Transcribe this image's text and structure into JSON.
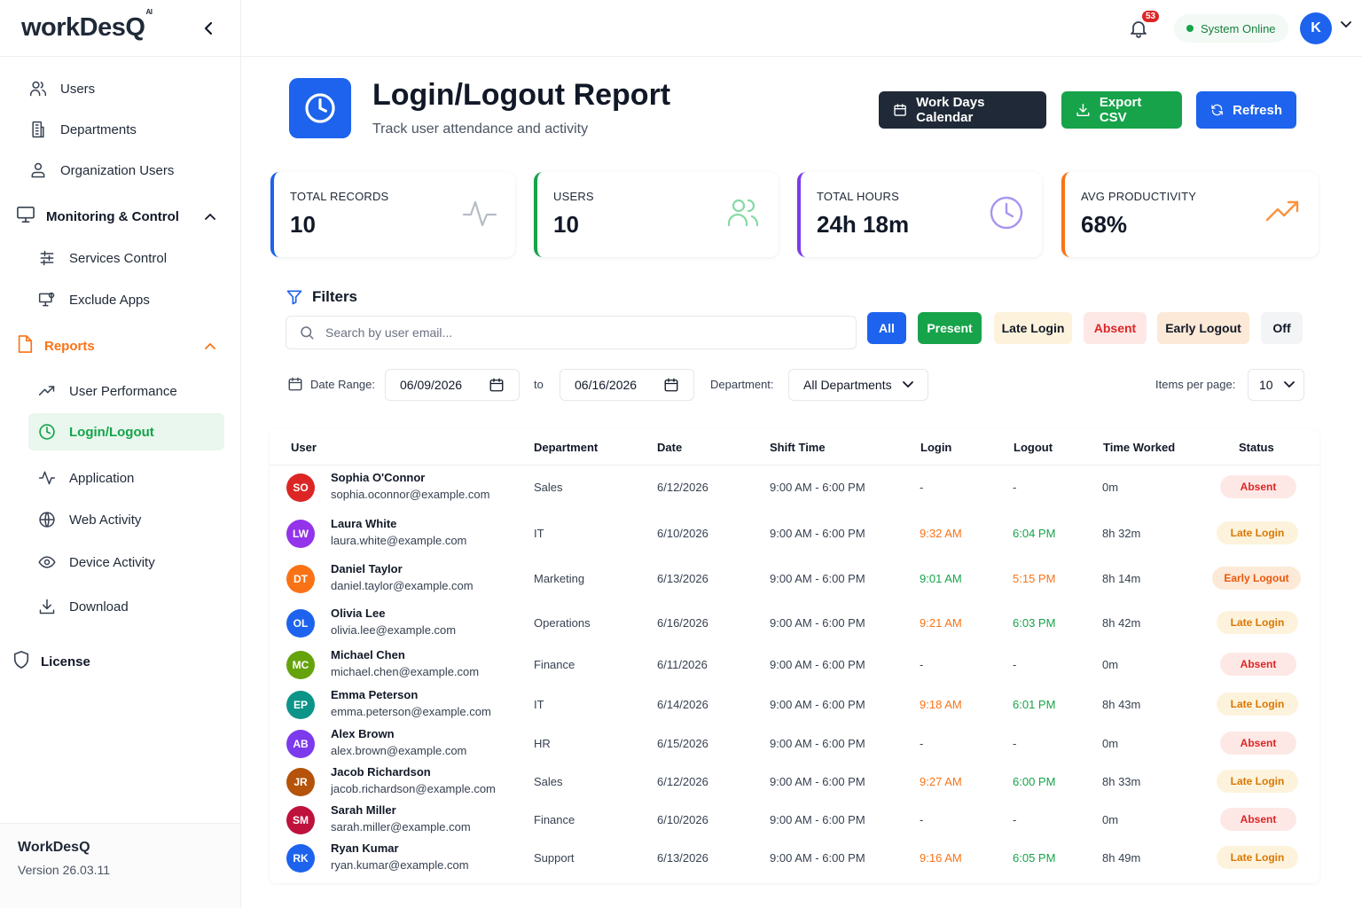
{
  "app": {
    "logo": "workDesQ",
    "logo_sup": "AI"
  },
  "sidebar": {
    "items": [
      {
        "label": "Users",
        "icon": "users-icon"
      },
      {
        "label": "Departments",
        "icon": "building-icon"
      },
      {
        "label": "Organization Users",
        "icon": "org-users-icon"
      }
    ],
    "monitoring": {
      "label": "Monitoring & Control",
      "children": [
        {
          "label": "Services Control",
          "icon": "sliders-icon"
        },
        {
          "label": "Exclude Apps",
          "icon": "monitor-gear-icon"
        }
      ]
    },
    "reports": {
      "label": "Reports",
      "children": [
        {
          "label": "User Performance",
          "icon": "trend-icon"
        },
        {
          "label": "Login/Logout",
          "icon": "clock-icon"
        },
        {
          "label": "Application",
          "icon": "activity-icon"
        },
        {
          "label": "Web Activity",
          "icon": "globe-icon"
        },
        {
          "label": "Device Activity",
          "icon": "eye-icon"
        },
        {
          "label": "Download",
          "icon": "download-icon"
        }
      ]
    },
    "license": "License",
    "footer": {
      "app_name": "WorkDesQ",
      "version": "Version 26.03.11"
    }
  },
  "topbar": {
    "notifications": "53",
    "status": "System Online",
    "avatar": "K"
  },
  "header": {
    "title": "Login/Logout Report",
    "subtitle": "Track user attendance and activity",
    "buttons": {
      "calendar": "Work Days Calendar",
      "export": "Export CSV",
      "refresh": "Refresh"
    }
  },
  "stats": [
    {
      "label": "TOTAL RECORDS",
      "value": "10",
      "color": "#1d63ed"
    },
    {
      "label": "USERS",
      "value": "10",
      "color": "#16a34a"
    },
    {
      "label": "TOTAL HOURS",
      "value": "24h 18m",
      "color": "#7c3aed"
    },
    {
      "label": "AVG PRODUCTIVITY",
      "value": "68%",
      "color": "#f97316"
    }
  ],
  "filters": {
    "title": "Filters",
    "search_placeholder": "Search by user email...",
    "chips": [
      "All",
      "Present",
      "Late Login",
      "Absent",
      "Early Logout",
      "Off"
    ],
    "date_range_label": "Date Range:",
    "date_from": "06/09/2026",
    "to_label": "to",
    "date_to": "06/16/2026",
    "department_label": "Department:",
    "department_value": "All Departments",
    "items_per_page_label": "Items per page:",
    "items_per_page": "10"
  },
  "table": {
    "columns": [
      "User",
      "Department",
      "Date",
      "Shift Time",
      "Login",
      "Logout",
      "Time Worked",
      "Status"
    ],
    "rows": [
      {
        "initials": "SO",
        "color": "#dc2626",
        "name": "Sophia O'Connor",
        "email": "sophia.oconnor@example.com",
        "dept": "Sales",
        "date": "6/12/2026",
        "shift": "9:00 AM - 6:00 PM",
        "login": "-",
        "logout": "-",
        "worked": "0m",
        "status": "Absent"
      },
      {
        "initials": "LW",
        "color": "#9333ea",
        "name": "Laura White",
        "email": "laura.white@example.com",
        "dept": "IT",
        "date": "6/10/2026",
        "shift": "9:00 AM - 6:00 PM",
        "login": "9:32 AM",
        "logout": "6:04 PM",
        "worked": "8h 32m",
        "status": "Late Login"
      },
      {
        "initials": "DT",
        "color": "#f97316",
        "name": "Daniel Taylor",
        "email": "daniel.taylor@example.com",
        "dept": "Marketing",
        "date": "6/13/2026",
        "shift": "9:00 AM - 6:00 PM",
        "login": "9:01 AM",
        "logout": "5:15 PM",
        "worked": "8h 14m",
        "status": "Early Logout"
      },
      {
        "initials": "OL",
        "color": "#1d63ed",
        "name": "Olivia Lee",
        "email": "olivia.lee@example.com",
        "dept": "Operations",
        "date": "6/16/2026",
        "shift": "9:00 AM - 6:00 PM",
        "login": "9:21 AM",
        "logout": "6:03 PM",
        "worked": "8h 42m",
        "status": "Late Login"
      },
      {
        "initials": "MC",
        "color": "#65a30d",
        "name": "Michael Chen",
        "email": "michael.chen@example.com",
        "dept": "Finance",
        "date": "6/11/2026",
        "shift": "9:00 AM - 6:00 PM",
        "login": "-",
        "logout": "-",
        "worked": "0m",
        "status": "Absent"
      },
      {
        "initials": "EP",
        "color": "#0d9488",
        "name": "Emma Peterson",
        "email": "emma.peterson@example.com",
        "dept": "IT",
        "date": "6/14/2026",
        "shift": "9:00 AM - 6:00 PM",
        "login": "9:18 AM",
        "logout": "6:01 PM",
        "worked": "8h 43m",
        "status": "Late Login"
      },
      {
        "initials": "AB",
        "color": "#7c3aed",
        "name": "Alex Brown",
        "email": "alex.brown@example.com",
        "dept": "HR",
        "date": "6/15/2026",
        "shift": "9:00 AM - 6:00 PM",
        "login": "-",
        "logout": "-",
        "worked": "0m",
        "status": "Absent"
      },
      {
        "initials": "JR",
        "color": "#b45309",
        "name": "Jacob Richardson",
        "email": "jacob.richardson@example.com",
        "dept": "Sales",
        "date": "6/12/2026",
        "shift": "9:00 AM - 6:00 PM",
        "login": "9:27 AM",
        "logout": "6:00 PM",
        "worked": "8h 33m",
        "status": "Late Login"
      },
      {
        "initials": "SM",
        "color": "#be123c",
        "name": "Sarah Miller",
        "email": "sarah.miller@example.com",
        "dept": "Finance",
        "date": "6/10/2026",
        "shift": "9:00 AM - 6:00 PM",
        "login": "-",
        "logout": "-",
        "worked": "0m",
        "status": "Absent"
      },
      {
        "initials": "RK",
        "color": "#1d63ed",
        "name": "Ryan Kumar",
        "email": "ryan.kumar@example.com",
        "dept": "Support",
        "date": "6/13/2026",
        "shift": "9:00 AM - 6:00 PM",
        "login": "9:16 AM",
        "logout": "6:05 PM",
        "worked": "8h 49m",
        "status": "Late Login"
      }
    ]
  }
}
